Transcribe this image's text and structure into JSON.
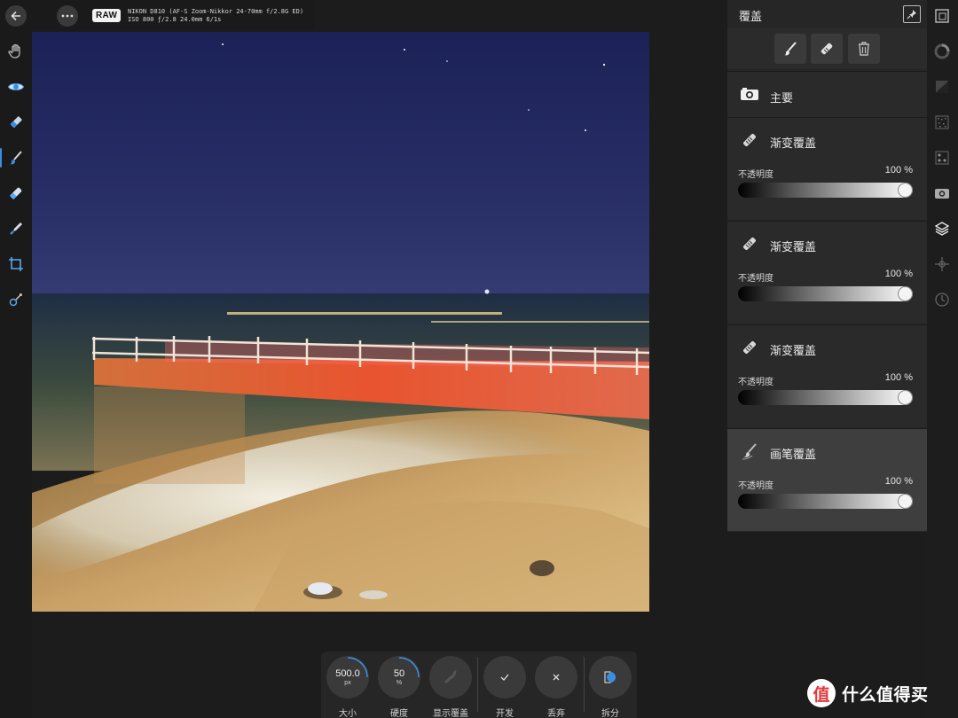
{
  "info": {
    "raw_badge": "RAW",
    "camera_line1": "NIKON D810 (AF-S Zoom-Nikkor 24-70mm f/2.8G ED)",
    "camera_line2": "ISO 800 ƒ/2.8 24.0mm 6/1s"
  },
  "left_tools": [
    "hand-tool",
    "view-tool",
    "overlay-eraser-tool",
    "overlay-brush-tool",
    "overlay-gradient-tool",
    "white-balance-picker-tool",
    "crop-tool",
    "red-eye-tool"
  ],
  "panel": {
    "title": "覆盖",
    "main_label": "主要",
    "overlays": [
      {
        "name": "渐变覆盖",
        "opacity_label": "不透明度",
        "opacity": "100 %",
        "kind": "gradient"
      },
      {
        "name": "渐变覆盖",
        "opacity_label": "不透明度",
        "opacity": "100 %",
        "kind": "gradient"
      },
      {
        "name": "渐变覆盖",
        "opacity_label": "不透明度",
        "opacity": "100 %",
        "kind": "gradient"
      },
      {
        "name": "画笔覆盖",
        "opacity_label": "不透明度",
        "opacity": "100 %",
        "kind": "brush",
        "selected": true
      }
    ]
  },
  "bottom": {
    "size_value": "500.0",
    "size_unit": "px",
    "size_label": "大小",
    "hardness_value": "50",
    "hardness_unit": "%",
    "hardness_label": "硬度",
    "show_overlay_label": "显示覆盖",
    "develop_label": "开发",
    "discard_label": "丢弃",
    "split_label": "拆分"
  },
  "studio": [
    "navigator-icon",
    "histogram-icon",
    "tones-icon",
    "noise-icon",
    "details-icon",
    "camera-icon",
    "layers-icon",
    "focus-icon",
    "history-icon"
  ],
  "colors": {
    "accent": "#3b8fe3",
    "panel": "#262626",
    "selected": "#3e3e3e"
  },
  "watermark": {
    "logo": "值",
    "text": "什么值得买"
  }
}
